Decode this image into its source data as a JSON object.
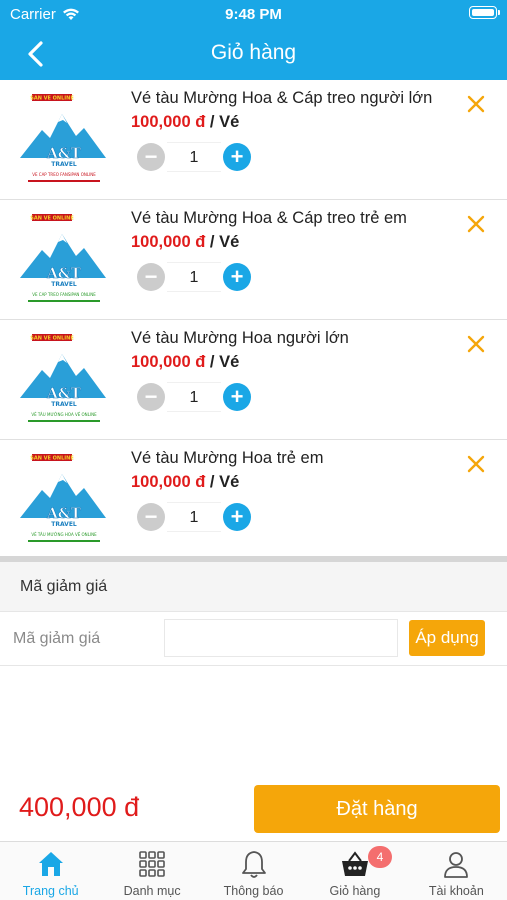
{
  "status_bar": {
    "carrier": "Carrier",
    "time": "9:48 PM"
  },
  "header": {
    "title": "Giỏ hàng"
  },
  "logo": {
    "brand": "A&T",
    "sub": "TRAVEL",
    "top_text": "SAN VE ONLINE"
  },
  "cart": {
    "items": [
      {
        "name": "Vé tàu Mường Hoa & Cáp treo người lớn",
        "price": "100,000 đ",
        "unit": "/ Vé",
        "quantity": "1",
        "caption": "VE CAP TREO FANSIPAN ONLINE"
      },
      {
        "name": "Vé tàu Mường Hoa & Cáp treo trẻ em",
        "price": "100,000 đ",
        "unit": "/ Vé",
        "quantity": "1",
        "caption": "VE CAP TREO FANSIPAN ONLINE"
      },
      {
        "name": "Vé tàu Mường Hoa người lớn",
        "price": "100,000 đ",
        "unit": "/ Vé",
        "quantity": "1",
        "caption": "VÉ TÀU MƯỜNG HOA VÉ ONLINE"
      },
      {
        "name": "Vé tàu Mường Hoa trẻ em",
        "price": "100,000 đ",
        "unit": "/ Vé",
        "quantity": "1",
        "caption": "VÉ TÀU MƯỜNG HOA VÉ ONLINE"
      }
    ]
  },
  "coupon": {
    "section_title": "Mã giảm giá",
    "label": "Mã giảm giá",
    "input_value": "",
    "apply_label": "Áp dụng"
  },
  "summary": {
    "total": "400,000 đ",
    "order_label": "Đặt hàng"
  },
  "tabbar": {
    "tabs": [
      {
        "label": "Trang chủ",
        "icon": "home-icon"
      },
      {
        "label": "Danh mục",
        "icon": "grid-icon"
      },
      {
        "label": "Thông báo",
        "icon": "bell-icon"
      },
      {
        "label": "Giỏ hàng",
        "icon": "basket-icon"
      },
      {
        "label": "Tài khoản",
        "icon": "user-icon"
      }
    ],
    "cart_badge": "4"
  },
  "colors": {
    "primary": "#1aa7e6",
    "accent": "#f5a60a",
    "price": "#e01b1b"
  }
}
